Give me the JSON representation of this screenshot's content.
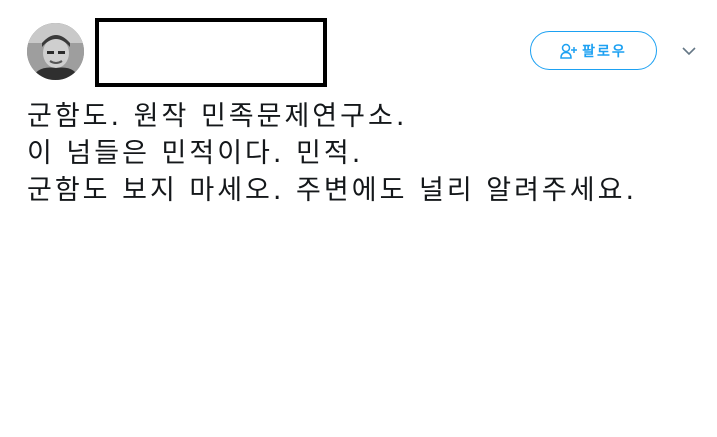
{
  "header": {
    "avatar_icon": "profile-photo",
    "name_redacted": true,
    "follow_button_label": "팔로우",
    "follow_icon": "person-plus-icon",
    "more_icon": "chevron-down-icon",
    "accent_color": "#1da1f2"
  },
  "tweet": {
    "text": "군함도. 원작 민족문제연구소.\n이 넘들은 민적이다. 민적.\n군함도 보지 마세오. 주변에도 널리 알려주세요."
  }
}
